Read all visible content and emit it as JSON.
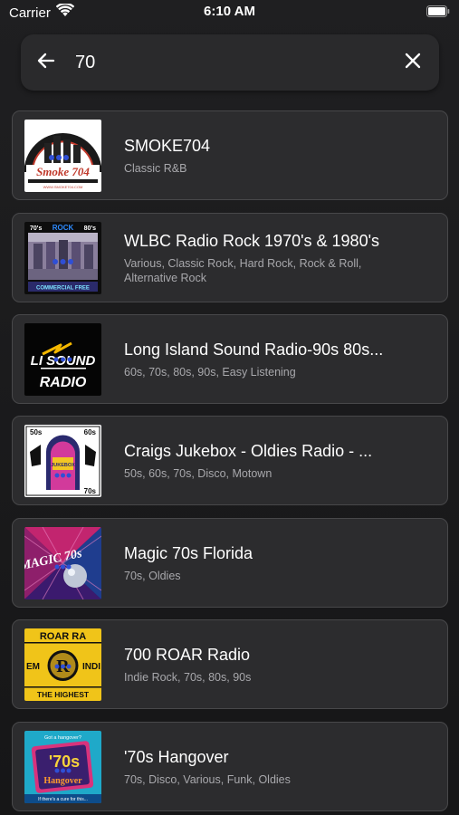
{
  "status_bar": {
    "carrier": "Carrier",
    "time": "6:10 AM",
    "icons": [
      "wifi-icon",
      "battery-icon"
    ]
  },
  "search": {
    "query": "70",
    "placeholder": "",
    "back_icon": "arrow-left-icon",
    "clear_icon": "close-icon"
  },
  "stations": [
    {
      "name": "SMOKE704",
      "genres": "Classic R&B",
      "art_text": "Smoke 704",
      "art_subtext": "WWW.SMOKE704.COM"
    },
    {
      "name": "WLBC Radio Rock 1970's & 1980's",
      "genres": "Various, Classic Rock, Hard Rock, Rock & Roll, Alternative Rock",
      "art_text_left": "70's",
      "art_text_mid": "ROCK",
      "art_text_right": "80's",
      "art_footer": "COMMERCIAL FREE"
    },
    {
      "name": "Long Island Sound Radio-90s 80s...",
      "genres": "60s, 70s, 80s, 90s, Easy Listening",
      "art_line1": "LI SOUND",
      "art_line2": "RADIO"
    },
    {
      "name": "Craigs Jukebox - Oldies Radio - ...",
      "genres": "50s, 60s, 70s, Disco, Motown",
      "art_tag_tl": "50s",
      "art_tag_tr": "60s",
      "art_tag_br": "70s",
      "art_text": "JUKEBOX"
    },
    {
      "name": "Magic 70s Florida",
      "genres": "70s, Oldies",
      "art_text": "MAGIC 70s"
    },
    {
      "name": "700 ROAR Radio",
      "genres": "Indie Rock, 70s, 80s, 90s",
      "art_top": "ROAR RA",
      "art_mid_left": "EM",
      "art_mid_right": "INDI",
      "art_bottom": "THE HIGHEST"
    },
    {
      "name": "'70s Hangover",
      "genres": "70s, Disco, Various, Funk, Oldies",
      "art_top": "Got a hangover?",
      "art_big": "'70s",
      "art_word": "Hangover",
      "art_footer": "If there's a cure for this..."
    }
  ],
  "colors": {
    "background": "#1c1c1e",
    "card": "#2c2c2e",
    "card_border": "#48484a",
    "secondary_text": "#a8a8ac"
  }
}
